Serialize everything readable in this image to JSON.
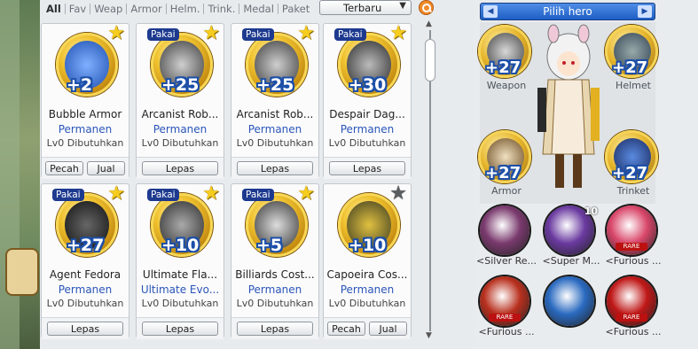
{
  "tabs": [
    "All",
    "Fav",
    "Weap",
    "Armor",
    "Helm.",
    "Trink.",
    "Medal",
    "Paket"
  ],
  "sort": {
    "selected": "Terbaru"
  },
  "colors": {
    "accent": "#2a55b8",
    "star": "#f6cc1e",
    "pakai_bg": "#1d3a8f",
    "hero_bar": "#1f5ec4"
  },
  "items": [
    {
      "name": "Bubble Armor",
      "duration": "Permanen",
      "req": "Lv0 Dibutuhkan",
      "plus": "+2",
      "equipped": false,
      "star": "gold",
      "buttons": [
        "Pecah",
        "Jual"
      ],
      "icon": "blue-armor-icon"
    },
    {
      "name": "Arcanist Rob...",
      "duration": "Permanen",
      "req": "Lv0 Dibutuhkan",
      "plus": "+25",
      "equipped": true,
      "pakai": "Pakai",
      "star": "gold",
      "buttons": [
        "Lepas"
      ],
      "icon": "robe-icon"
    },
    {
      "name": "Arcanist Rob...",
      "duration": "Permanen",
      "req": "Lv0 Dibutuhkan",
      "plus": "+25",
      "equipped": true,
      "pakai": "Pakai",
      "star": "gold",
      "buttons": [
        "Lepas"
      ],
      "icon": "robe-icon"
    },
    {
      "name": "Despair Dag...",
      "duration": "Permanen",
      "req": "Lv0 Dibutuhkan",
      "plus": "+30",
      "equipped": true,
      "pakai": "Pakai",
      "star": "gold",
      "buttons": [
        "Lepas"
      ],
      "icon": "dagger-icon"
    },
    {
      "name": "Agent Fedora",
      "duration": "Permanen",
      "req": "Lv0 Dibutuhkan",
      "plus": "+27",
      "equipped": true,
      "pakai": "Pakai",
      "star": "gold",
      "buttons": [
        "Lepas"
      ],
      "icon": "fedora-icon"
    },
    {
      "name": "Ultimate Fla...",
      "duration": "Ultimate Evo...",
      "req": "Lv0 Dibutuhkan",
      "plus": "+10",
      "equipped": true,
      "pakai": "Pakai",
      "star": "gold",
      "buttons": [
        "Lepas"
      ],
      "icon": "flask-icon"
    },
    {
      "name": "Billiards Cost...",
      "duration": "Permanen",
      "req": "Lv0 Dibutuhkan",
      "plus": "+5",
      "equipped": true,
      "pakai": "Pakai",
      "star": "gold",
      "buttons": [
        "Lepas"
      ],
      "icon": "vest-icon"
    },
    {
      "name": "Capoeira Cos...",
      "duration": "Permanen",
      "req": "Lv0 Dibutuhkan",
      "plus": "+10",
      "equipped": false,
      "star": "grey",
      "buttons": [
        "Pecah",
        "Jual"
      ],
      "icon": "capoeira-icon"
    }
  ],
  "hero": {
    "label": "Pilih hero"
  },
  "slots": [
    {
      "cap": "Weapon",
      "plus": "+27"
    },
    {
      "cap": "Helmet",
      "plus": "+27"
    },
    {
      "cap": "Armor",
      "plus": "+27"
    },
    {
      "cap": "Trinket",
      "plus": "+27"
    }
  ],
  "accessories": [
    {
      "cap": "<Silver Re...",
      "color": "#7a3a6e"
    },
    {
      "cap": "<Super M...",
      "color": "#6a3aa0",
      "count": "10"
    },
    {
      "cap": "<Furious ...",
      "color": "#d9476a",
      "rare": "RARE"
    },
    {
      "cap": "<Furious ...",
      "color": "#b8301e",
      "rare": "RARE"
    },
    {
      "cap": "",
      "color": "#2a6ac0"
    },
    {
      "cap": "<Furious ...",
      "color": "#c01818",
      "rare": "RARE"
    }
  ]
}
